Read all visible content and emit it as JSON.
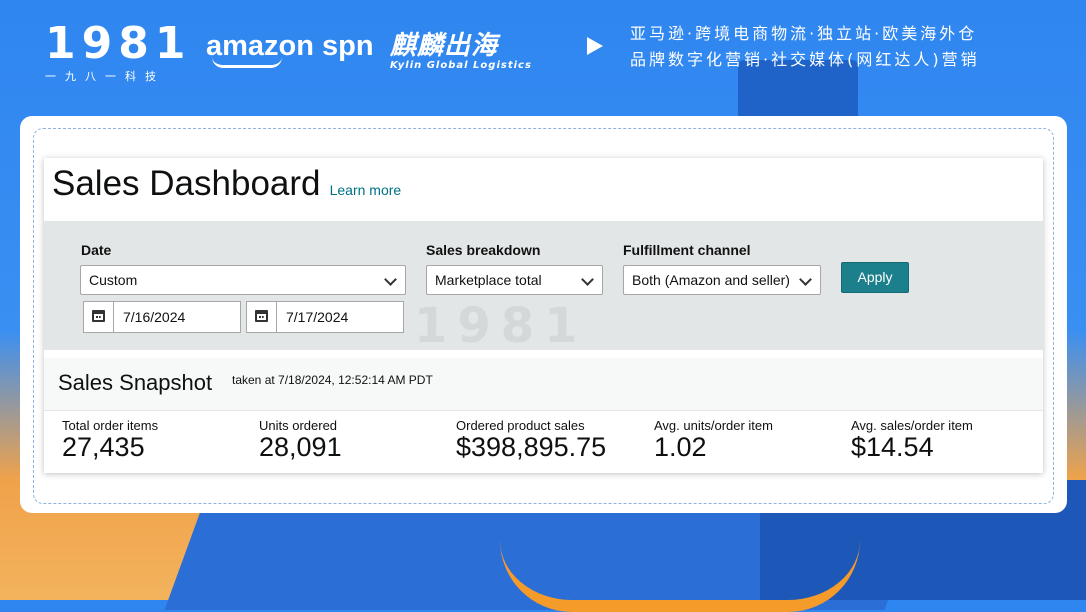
{
  "banner": {
    "logo_number": "1981",
    "logo_sub": "一九八一科技",
    "amazon_spn": "amazon spn",
    "kylin_cn": "麒麟出海",
    "kylin_en": "Kylin Global Logistics",
    "tagline_line1": "亚马逊·跨境电商物流·独立站·欧美海外仓",
    "tagline_line2": "品牌数字化营销·社交媒体(网红达人)营销"
  },
  "dashboard": {
    "title": "Sales Dashboard",
    "learn_more": "Learn more"
  },
  "filters": {
    "date_label": "Date",
    "date_select": "Custom",
    "start_date": "7/16/2024",
    "end_date": "7/17/2024",
    "breakdown_label": "Sales breakdown",
    "breakdown_select": "Marketplace total",
    "fulfillment_label": "Fulfillment channel",
    "fulfillment_select": "Both (Amazon and seller)",
    "apply_label": "Apply"
  },
  "snapshot": {
    "title": "Sales Snapshot",
    "taken": "taken at 7/18/2024, 12:52:14 AM PDT",
    "metrics": [
      {
        "label": "Total order items",
        "value": "27,435"
      },
      {
        "label": "Units ordered",
        "value": "28,091"
      },
      {
        "label": "Ordered product sales",
        "value": "$398,895.75"
      },
      {
        "label": "Avg. units/order item",
        "value": "1.02"
      },
      {
        "label": "Avg. sales/order item",
        "value": "$14.54"
      }
    ]
  },
  "watermark": "1981"
}
